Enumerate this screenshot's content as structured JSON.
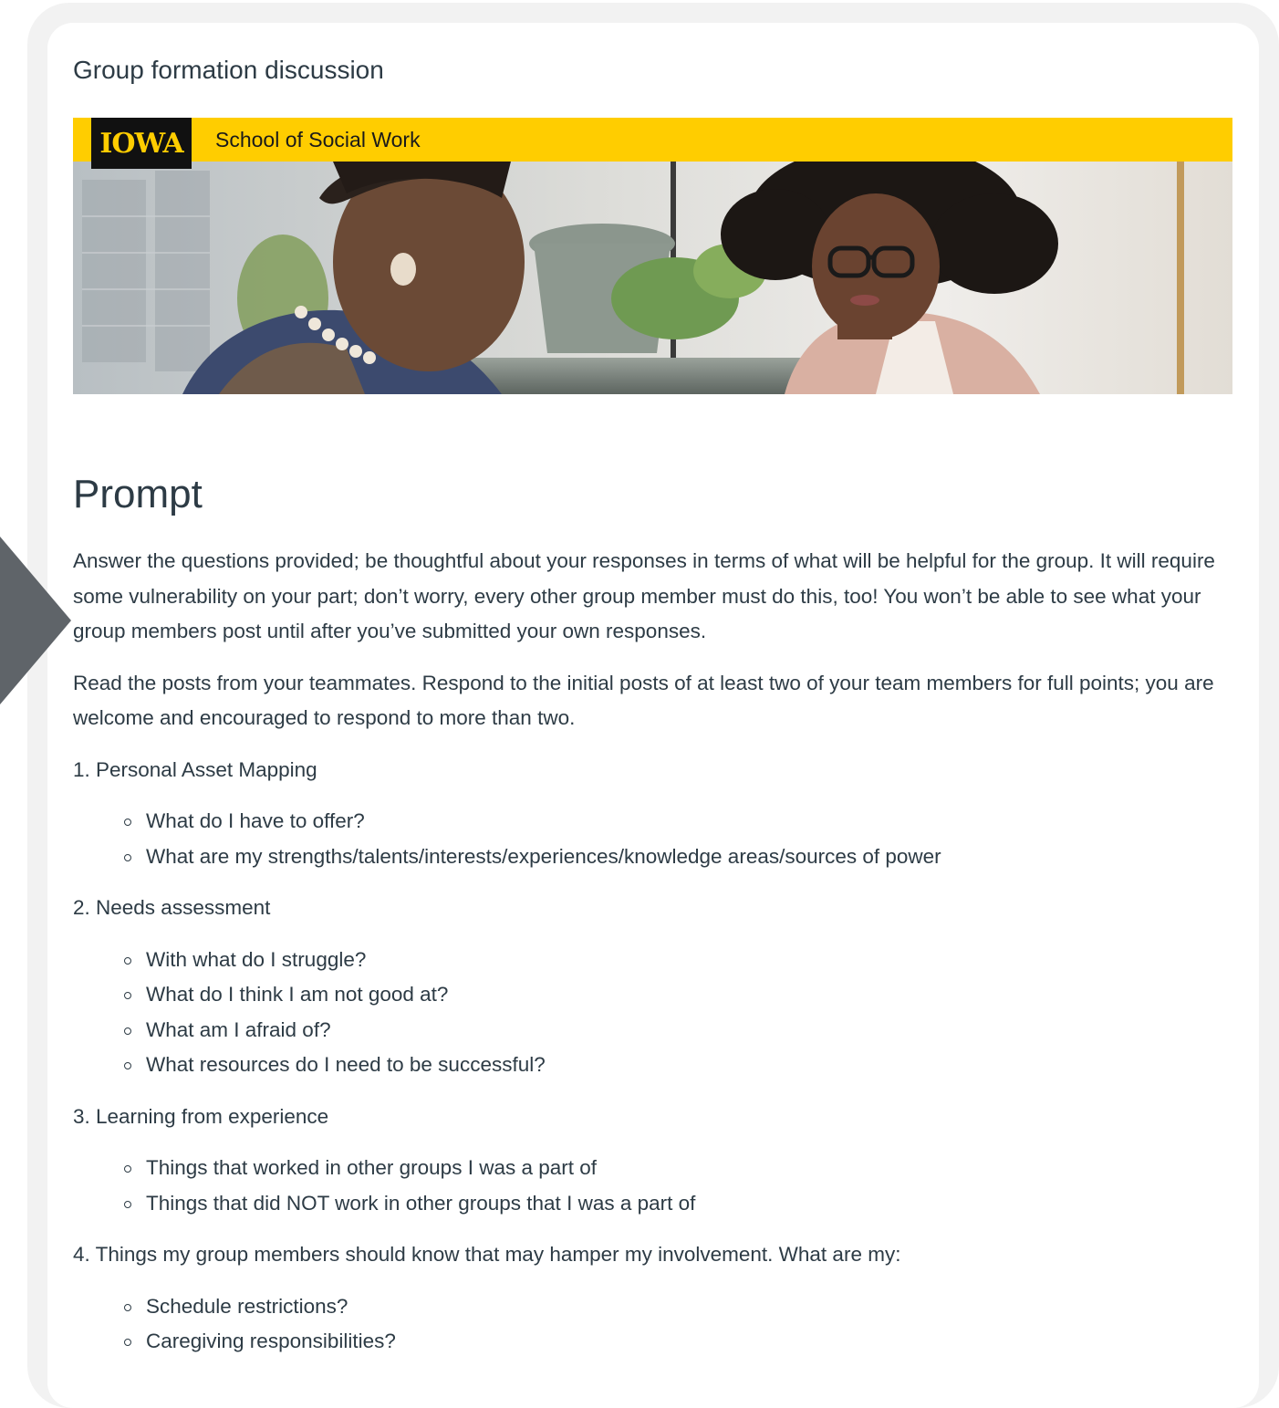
{
  "page": {
    "title": "Group formation discussion"
  },
  "banner": {
    "logo_text": "IOWA",
    "school": "School of Social Work"
  },
  "prompt": {
    "heading": "Prompt",
    "paragraphs": [
      "Answer the questions provided; be thoughtful about your responses in terms of what will be helpful for the group. It will require some vulnerability on your part; don’t worry, every other group member must do this, too! You won’t be able to see what your group members post until after you’ve submitted your own responses.",
      "Read the posts from your teammates. Respond to the initial posts of at least two of your team members for full points; you are welcome and encouraged to respond to more than two."
    ],
    "sections": [
      {
        "heading": "1. Personal Asset Mapping",
        "items": [
          "What do I have to offer?",
          "What are my strengths/talents/interests/experiences/knowledge areas/sources of power"
        ]
      },
      {
        "heading": "2. Needs assessment",
        "items": [
          "With what do I struggle?",
          "What do I think I am not good at?",
          "What am I afraid of?",
          "What resources do I need to be successful?"
        ]
      },
      {
        "heading": "3. Learning from experience",
        "items": [
          "Things that worked in other groups I was a part of",
          "Things that did NOT work in other groups that I was a part of"
        ]
      },
      {
        "heading": "4. Things my group members should know that may hamper my involvement. What are my:",
        "items": [
          "Schedule restrictions?",
          "Caregiving responsibilities?"
        ]
      }
    ]
  },
  "colors": {
    "brand_gold": "#ffcd00",
    "brand_black": "#111111",
    "text": "#2d3b45",
    "frame": "#f2f2f2",
    "pointer": "#5f6469"
  },
  "icons": {
    "pointer": "pointer-arrow-icon",
    "logo": "iowa-logo"
  }
}
